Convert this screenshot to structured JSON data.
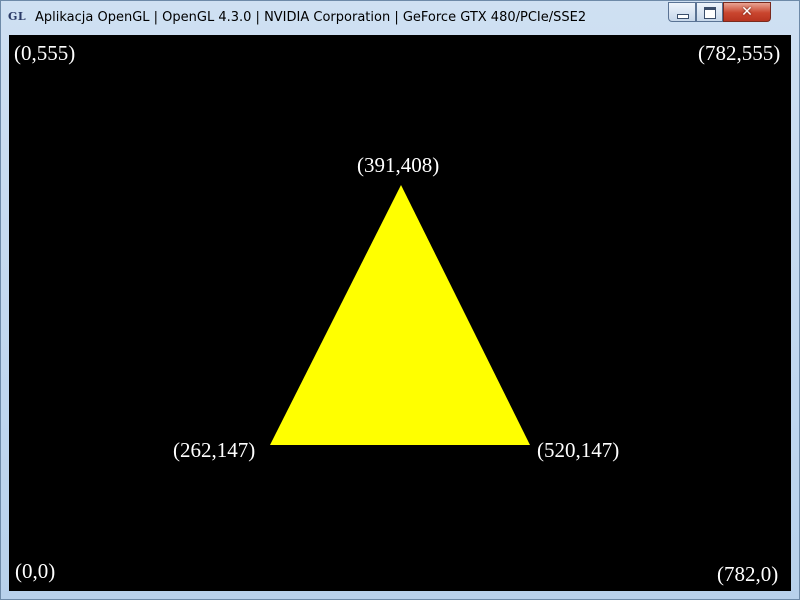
{
  "window": {
    "icon_text": "GL",
    "title": "Aplikacja OpenGL | OpenGL 4.3.0 | NVIDIA Corporation | GeForce GTX 480/PCIe/SSE2",
    "close_glyph": "✕"
  },
  "canvas": {
    "background": "#000000",
    "fill_color": "#ffff00",
    "corner_labels": {
      "top_left": "(0,555)",
      "top_right": "(782,555)",
      "bottom_left": "(0,0)",
      "bottom_right": "(782,0)"
    },
    "vertex_labels": {
      "apex": "(391,408)",
      "left": "(262,147)",
      "right": "(520,147)"
    }
  }
}
